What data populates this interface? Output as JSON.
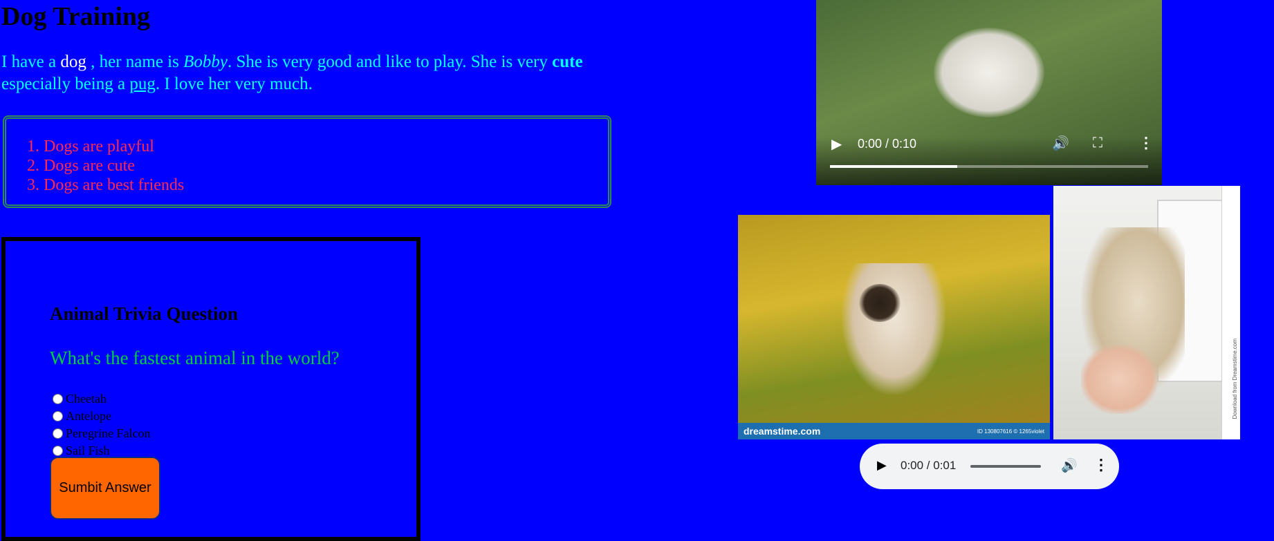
{
  "page": {
    "title": "Dog Training",
    "intro": {
      "t1": "I have a ",
      "dog_word": "dog",
      "t2": " , her name is ",
      "name": "Bobby",
      "t3": ". She is very good and like to play. She is very ",
      "cute": "cute",
      "t4": " especially being a ",
      "breed": "pug",
      "t5": ". I love her very much."
    }
  },
  "facts": [
    "Dogs are playful",
    "Dogs are cute",
    "Dogs are best friends"
  ],
  "quiz": {
    "heading": "Animal Trivia Question",
    "question": "What's the fastest animal in the world?",
    "options": [
      "Cheetah",
      "Antelope",
      "Peregrine Falcon",
      "Sail Fish"
    ],
    "submit_label": "Sumbit Answer"
  },
  "video": {
    "time": "0:00 / 0:10",
    "progress": 0.4
  },
  "audio": {
    "time": "0:00 / 0:01"
  },
  "images": {
    "pic1_banner": "dreamstime.com",
    "pic1_id": "ID 130807616 © 1265violet",
    "pic2_side": "Download from Dreamstime.com"
  },
  "icons": {
    "play": "play-icon",
    "volume": "volume-icon",
    "fullscreen": "fullscreen-icon",
    "menu": "more-vert-icon"
  },
  "colors": {
    "background": "#0000ff",
    "intro_text": "#00ffff",
    "facts_text": "#ff2a55",
    "question_text": "#00cc44",
    "button": "#ff6600"
  }
}
